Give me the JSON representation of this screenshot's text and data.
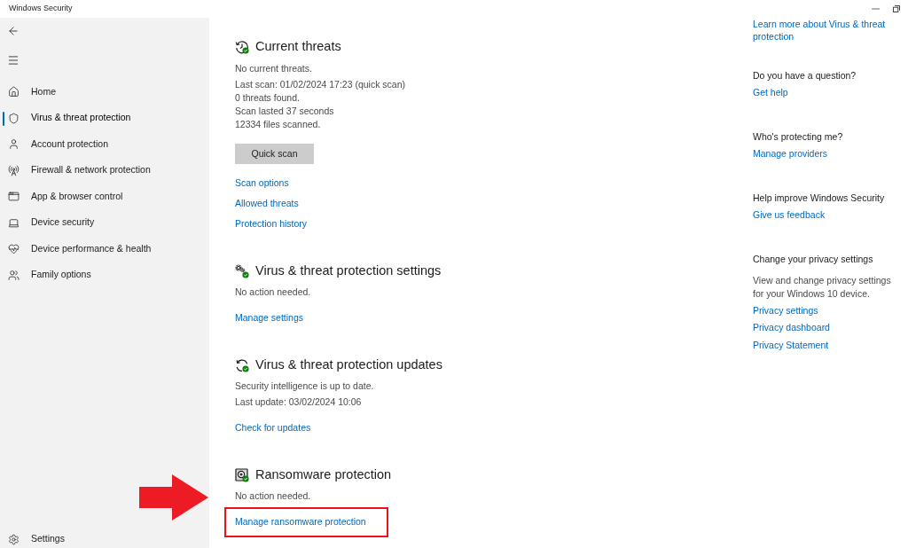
{
  "window": {
    "title": "Windows Security"
  },
  "sidebar": {
    "items": [
      {
        "label": "Home",
        "selected": false
      },
      {
        "label": "Virus & threat protection",
        "selected": true
      },
      {
        "label": "Account protection",
        "selected": false
      },
      {
        "label": "Firewall & network protection",
        "selected": false
      },
      {
        "label": "App & browser control",
        "selected": false
      },
      {
        "label": "Device security",
        "selected": false
      },
      {
        "label": "Device performance & health",
        "selected": false
      },
      {
        "label": "Family options",
        "selected": false
      }
    ],
    "footer": {
      "label": "Settings"
    }
  },
  "sections": [
    {
      "title": "Current threats",
      "status": "No current threats.",
      "details": [
        "Last scan: 01/02/2024 17:23 (quick scan)",
        "0 threats found.",
        "Scan lasted 37 seconds",
        "12334 files scanned."
      ],
      "button": "Quick scan",
      "links": [
        {
          "label": "Scan options",
          "highlighted": false
        },
        {
          "label": "Allowed threats",
          "highlighted": false
        },
        {
          "label": "Protection history",
          "highlighted": false
        }
      ]
    },
    {
      "title": "Virus & threat protection settings",
      "status": "No action needed.",
      "links": [
        {
          "label": "Manage settings",
          "highlighted": false
        }
      ]
    },
    {
      "title": "Virus & threat protection updates",
      "status": "Security intelligence is up to date.",
      "details": [
        "Last update: 03/02/2024 10:06"
      ],
      "links": [
        {
          "label": "Check for updates",
          "highlighted": false
        }
      ]
    },
    {
      "title": "Ransomware protection",
      "status": "No action needed.",
      "links": [
        {
          "label": "Manage ransomware protection",
          "highlighted": true
        }
      ]
    }
  ],
  "aside": {
    "top_link": "Learn more about Virus & threat protection",
    "groups": [
      {
        "heading": "Do you have a question?",
        "links": [
          "Get help"
        ]
      },
      {
        "heading": "Who's protecting me?",
        "links": [
          "Manage providers"
        ]
      },
      {
        "heading": "Help improve Windows Security",
        "links": [
          "Give us feedback"
        ]
      },
      {
        "heading": "Change your privacy settings",
        "text": "View and change privacy settings for your Windows 10 device.",
        "links": [
          "Privacy settings",
          "Privacy dashboard",
          "Privacy Statement"
        ]
      }
    ]
  }
}
